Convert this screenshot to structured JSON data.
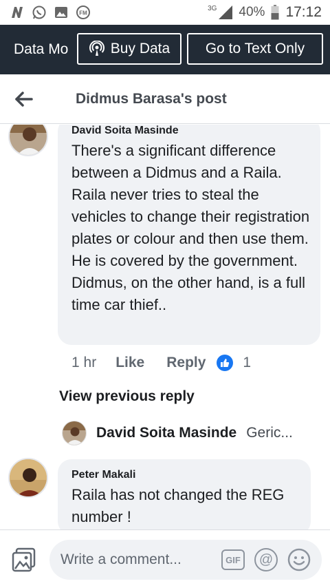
{
  "status_bar": {
    "network": "3G",
    "battery": "40%",
    "time": "17:12",
    "icons": [
      "n-icon",
      "whatsapp-icon",
      "gallery-icon",
      "fm-radio-icon",
      "signal-icon",
      "battery-icon"
    ]
  },
  "data_bar": {
    "mode_label": "Data Mo",
    "buy_label": "Buy Data",
    "text_only_label": "Go to Text Only"
  },
  "header": {
    "title": "Didmus Barasa's post"
  },
  "comments": [
    {
      "author": "David Soita Masinde",
      "text": "There's a significant difference between a Didmus and a Raila. Raila never tries to steal the vehicles to change their registration plates or colour and then use them. He is covered by the government. Didmus, on the other hand, is a full time car thief..",
      "time": "1 hr",
      "like_label": "Like",
      "reply_label": "Reply",
      "reaction_count": "1"
    },
    {
      "author": "Peter Makali",
      "text": "Raila has not changed the REG number !"
    }
  ],
  "previous_reply": {
    "label": "View previous reply",
    "author": "David Soita Masinde",
    "snippet": "Geric..."
  },
  "composer": {
    "placeholder": "Write a comment...",
    "gif_label": "GIF",
    "at_label": "@"
  },
  "colors": {
    "data_bar_bg": "#222b36",
    "bubble_bg": "#f0f2f5",
    "like_blue": "#1877f2"
  }
}
